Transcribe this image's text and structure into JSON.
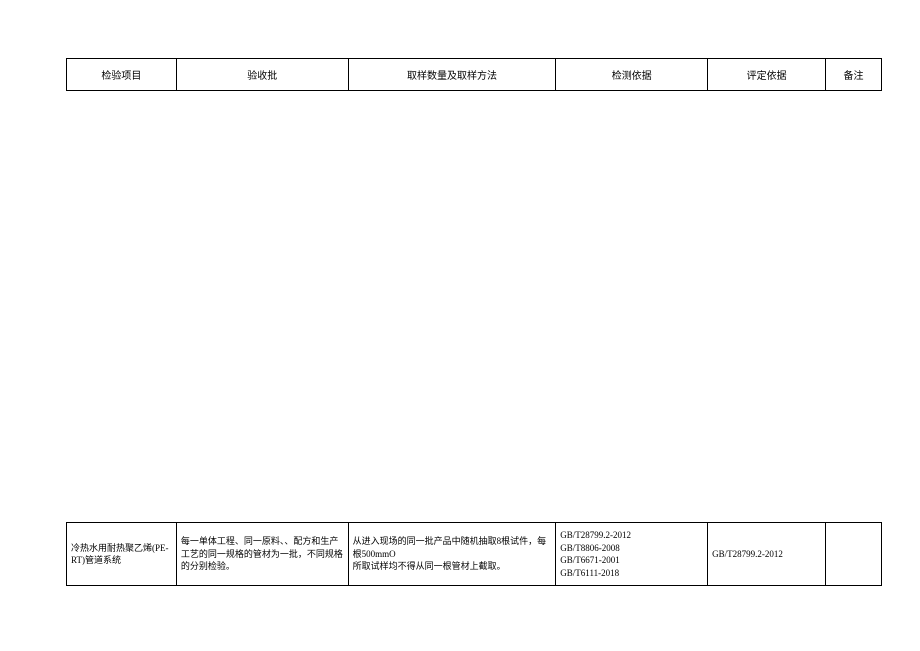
{
  "header": {
    "columns": [
      "检验项目",
      "验收批",
      "取样数量及取样方法",
      "检测依据",
      "评定依据",
      "备注"
    ]
  },
  "data_row": {
    "inspection_item": "冷热水用耐热聚乙烯(PE-RT)管道系统",
    "acceptance_batch": "每一单体工程、同一原料、、配方和生产工艺的同一规格的管材为一批，不同规格的分别检验。",
    "sampling": "从进入现场的同一批产品中随机抽取8根试件，每根500mmO\n所取试样均不得从同一根管材上截取。",
    "test_basis": "GB/T28799.2-2012\nGB/T8806-2008\nGB/T6671-2001\nGB/T6111-2018",
    "evaluation_basis": "GB/T28799.2-2012",
    "remarks": ""
  }
}
